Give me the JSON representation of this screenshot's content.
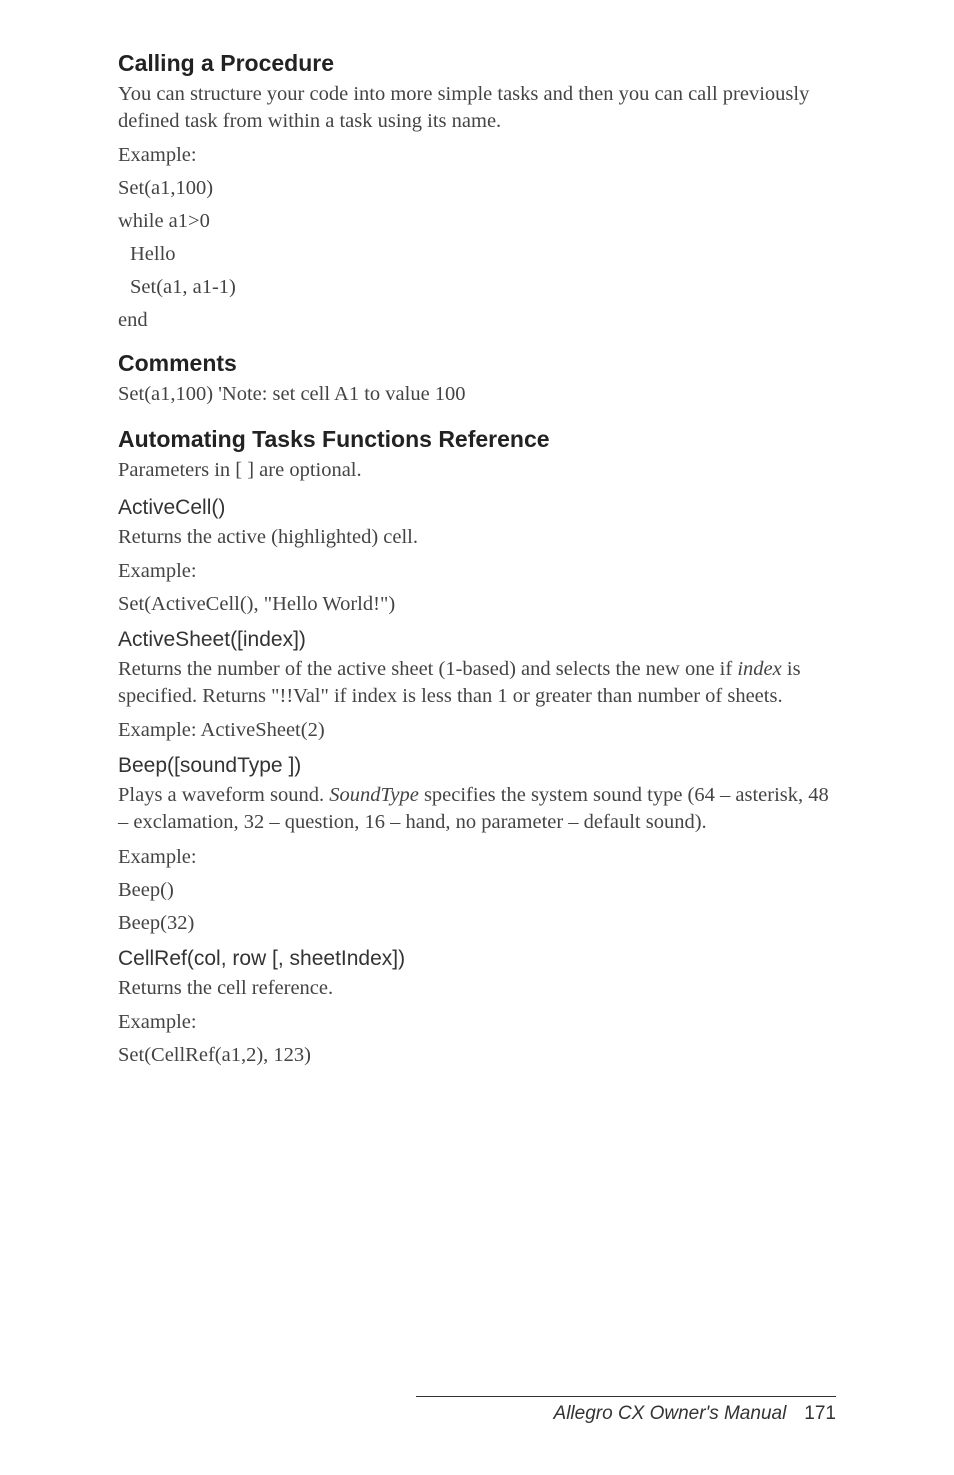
{
  "section1": {
    "heading": "Calling a Procedure",
    "para": "You can structure your code into more simple tasks and then you can call previously defined task from within a task using its name.",
    "example_label": "Example:",
    "lines": [
      "Set(a1,100)",
      "while a1>0",
      "Hello",
      "Set(a1, a1-1)",
      "end"
    ]
  },
  "section2": {
    "heading": "Comments",
    "line": "Set(a1,100)  'Note: set cell A1 to value 100"
  },
  "section3": {
    "heading": "Automating Tasks Functions Reference",
    "para": "Parameters in [ ] are optional."
  },
  "activecell": {
    "heading": "ActiveCell()",
    "para": "Returns the active (highlighted) cell.",
    "example_label": "Example:",
    "code": "Set(ActiveCell(), \"Hello World!\")"
  },
  "activesheet": {
    "heading": "ActiveSheet([index])",
    "para_pre": "Returns the number of the active sheet (1-based) and selects the new one if ",
    "para_italic": "index",
    "para_post": " is specified. Returns \"!!Val\"  if index is less than 1 or greater than number of sheets.",
    "example": "Example: ActiveSheet(2)"
  },
  "beep": {
    "heading": "Beep([soundType ])",
    "para_pre": "Plays a waveform sound. ",
    "para_italic": "SoundType",
    "para_post": " specifies the system sound type (64 – asterisk, 48 – exclamation, 32 – question, 16 – hand, no parameter – default sound).",
    "example_label": "Example:",
    "code1": "Beep()",
    "code2": "Beep(32)"
  },
  "cellref": {
    "heading": "CellRef(col, row [, sheetIndex])",
    "para": "Returns the cell reference.",
    "example_label": "Example:",
    "code": "Set(CellRef(a1,2), 123)"
  },
  "footer": {
    "title": "Allegro CX Owner's Manual",
    "page": "171"
  }
}
